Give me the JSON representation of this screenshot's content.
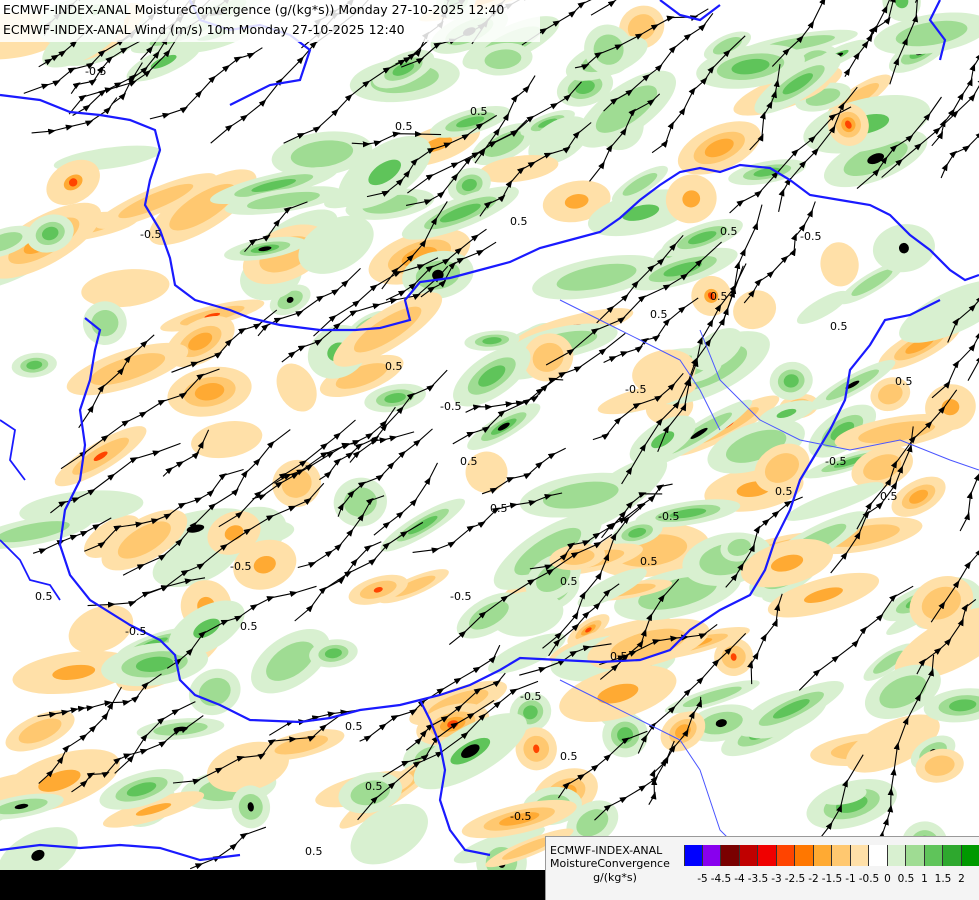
{
  "titles": {
    "line1": "ECMWF-INDEX-ANAL MoistureConvergence (g/(kg*s)) Monday 27-10-2025 12:40",
    "line2": "ECMWF-INDEX-ANAL Wind (m/s) 10m Monday 27-10-2025 12:40"
  },
  "legend": {
    "line1": "ECMWF-INDEX-ANAL",
    "line2": "MoistureConvergence",
    "unit": "g/(kg*s)",
    "ticks": [
      "-5",
      "-4.5",
      "-4",
      "-3.5",
      "-3",
      "-2.5",
      "-2",
      "-1.5",
      "-1",
      "-0.5",
      "0",
      "0.5",
      "1",
      "1.5",
      "2"
    ],
    "colors": [
      "#0000ff",
      "#8800ee",
      "#7a0000",
      "#c00000",
      "#f00000",
      "#ff4400",
      "#ff7700",
      "#ffaa33",
      "#ffc870",
      "#ffe0a8",
      "#ffffff",
      "#d8f0d0",
      "#9fdc93",
      "#5fc45a",
      "#2ea82e",
      "#009900"
    ]
  },
  "contour_labels": [
    "-0.5",
    "0.5"
  ],
  "colors": {
    "border": "#1a1aff",
    "streamline": "#000000",
    "dark_core": "#000000"
  }
}
